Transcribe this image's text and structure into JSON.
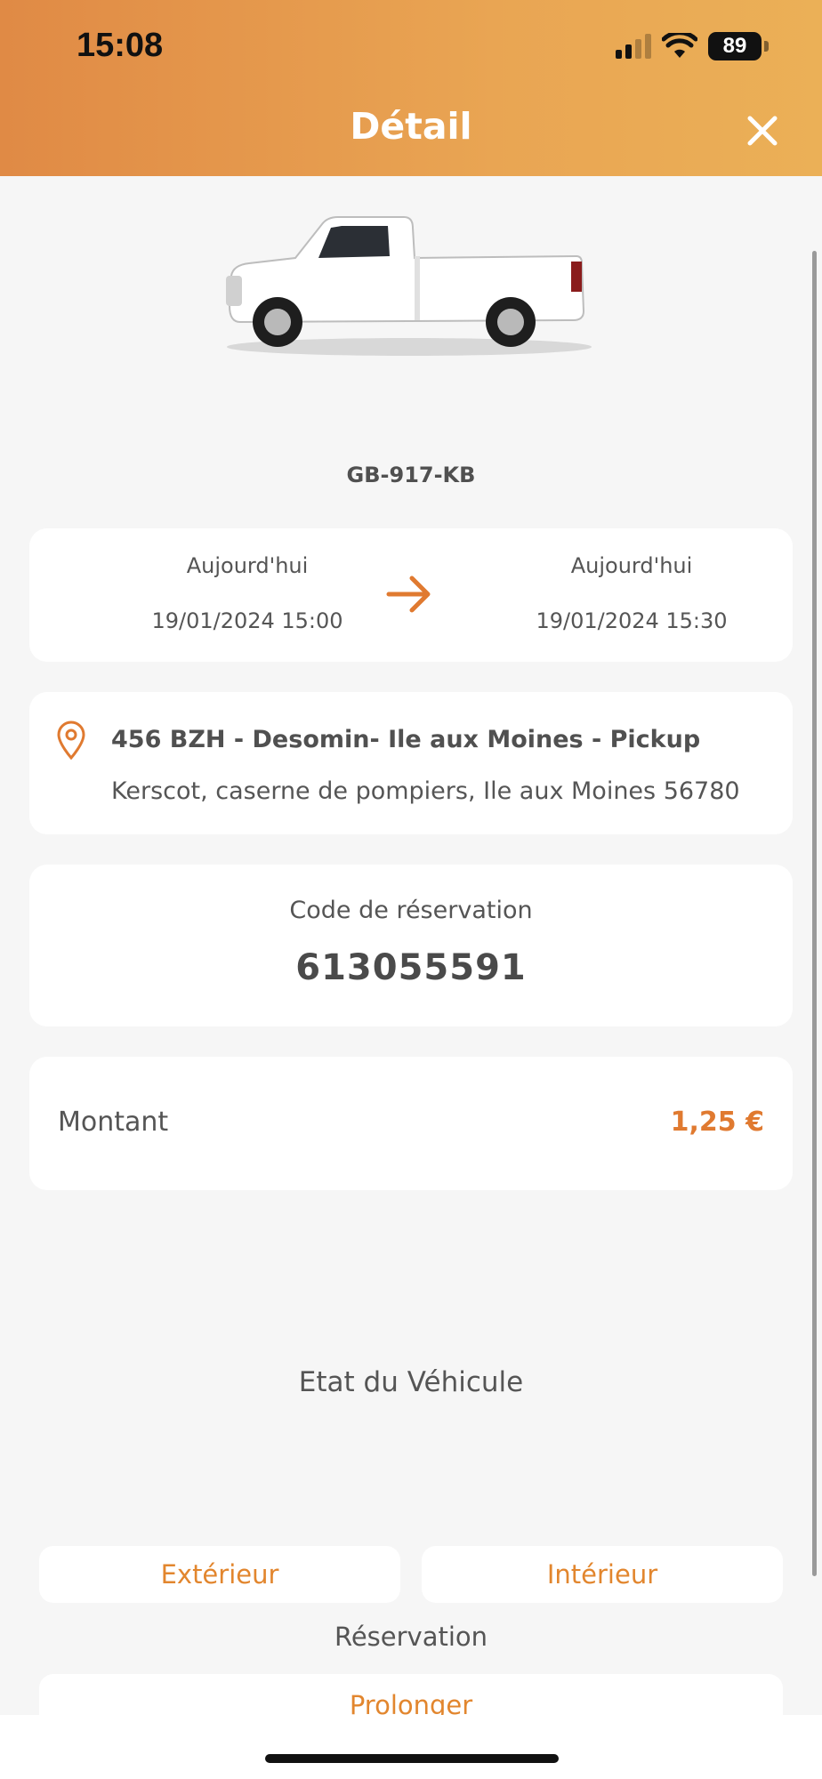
{
  "status_bar": {
    "time": "15:08",
    "battery": "89"
  },
  "header": {
    "title": "Détail",
    "close_icon": "close-icon"
  },
  "vehicle": {
    "plate": "GB-917-KB",
    "image": "white-pickup-truck"
  },
  "dates": {
    "start": {
      "day": "Aujourd'hui",
      "datetime": "19/01/2024 15:00"
    },
    "end": {
      "day": "Aujourd'hui",
      "datetime": "19/01/2024 15:30"
    },
    "arrow_icon": "arrow-right-icon"
  },
  "location": {
    "icon": "location-pin-icon",
    "name": "456 BZH - Desomin- Ile aux Moines -  Pickup",
    "address": "Kerscot, caserne de pompiers, Ile aux Moines 56780"
  },
  "reservation_code": {
    "label": "Code de réservation",
    "value": "613055591"
  },
  "amount": {
    "label": "Montant",
    "value": "1,25 €"
  },
  "vehicle_state": {
    "title": "Etat du Véhicule",
    "exterior_button": "Extérieur",
    "interior_button": "Intérieur"
  },
  "reservation": {
    "label": "Réservation",
    "extend_button": "Prolonger"
  },
  "colors": {
    "accent": "#e2862e",
    "header_start": "#e08a45",
    "header_end": "#ebb057"
  }
}
